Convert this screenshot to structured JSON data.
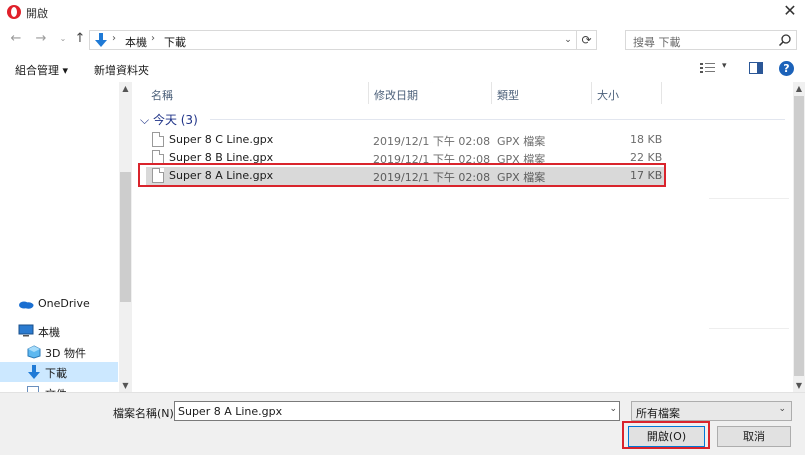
{
  "window": {
    "title": "開啟",
    "close_glyph": "✕"
  },
  "nav": {
    "back_glyph": "←",
    "forward_glyph": "→",
    "recent_glyph": "⌄",
    "up_glyph": "↑"
  },
  "address": {
    "crumbs": [
      "本機",
      "下載"
    ],
    "sep_glyph": "›",
    "dropdown_glyph": "⌄",
    "refresh_glyph": "⟳"
  },
  "search": {
    "placeholder": "搜尋 下載"
  },
  "toolbar": {
    "organize_label": "組合管理 ▾",
    "new_folder_label": "新增資料夾",
    "view_dropdown_glyph": "▾",
    "help_label": "?"
  },
  "sidebar": {
    "items": [
      {
        "label": "OneDrive",
        "icon": "onedrive-icon"
      },
      {
        "label": "本機",
        "icon": "pc-icon"
      },
      {
        "label": "3D 物件",
        "icon": "3d-objects-icon"
      },
      {
        "label": "下載",
        "icon": "download-icon",
        "selected": true
      },
      {
        "label": "文件",
        "icon": "documents-icon"
      }
    ],
    "scroll_up_glyph": "▲",
    "scroll_down_glyph": "▼"
  },
  "list": {
    "columns": [
      "名稱",
      "修改日期",
      "類型",
      "大小"
    ],
    "sort_glyph": "⌃",
    "group": {
      "label": "今天 (3)",
      "chevron": "⌵"
    },
    "files": [
      {
        "name": "Super 8 C Line.gpx",
        "modified": "2019/12/1 下午 02:08",
        "type": "GPX 檔案",
        "size": "18 KB",
        "selected": false
      },
      {
        "name": "Super 8 B Line.gpx",
        "modified": "2019/12/1 下午 02:08",
        "type": "GPX 檔案",
        "size": "22 KB",
        "selected": false
      },
      {
        "name": "Super 8 A Line.gpx",
        "modified": "2019/12/1 下午 02:08",
        "type": "GPX 檔案",
        "size": "17 KB",
        "selected": true
      }
    ],
    "scroll_up_glyph": "▲",
    "scroll_down_glyph": "▼"
  },
  "footer": {
    "filename_label": "檔案名稱(N):",
    "filename_value": "Super 8 A Line.gpx",
    "filename_dropdown_glyph": "⌄",
    "filetype_value": "所有檔案",
    "filetype_dropdown_glyph": "⌄",
    "open_label": "開啟(O)",
    "cancel_label": "取消"
  },
  "colors": {
    "highlight_red": "#d9242c",
    "accent_blue": "#0078d7",
    "selected_row": "#d9d9d9",
    "group_text": "#1e3287"
  }
}
